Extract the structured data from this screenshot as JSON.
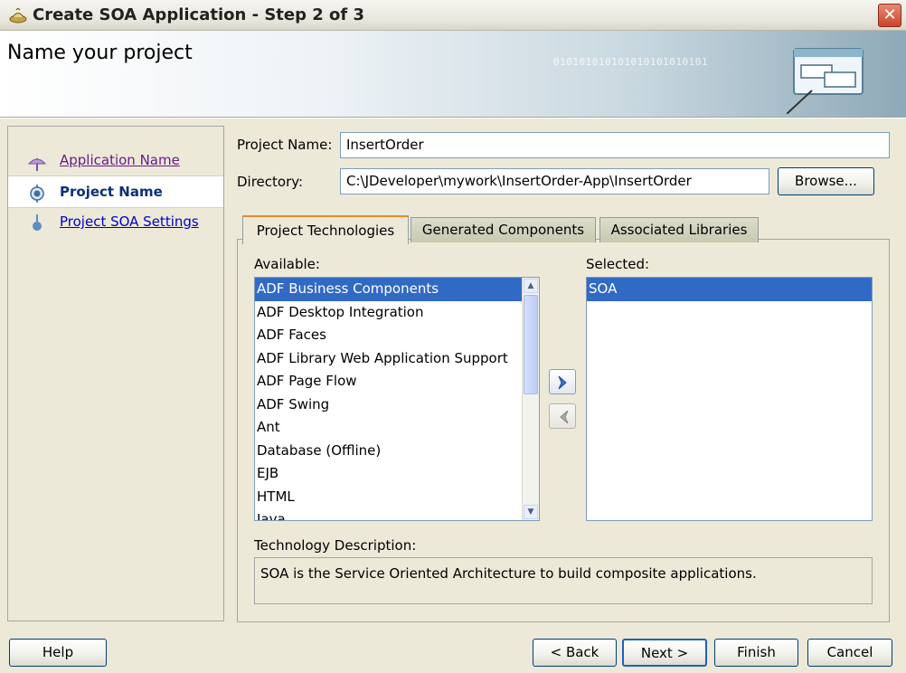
{
  "window": {
    "title": "Create SOA Application - Step 2 of 3",
    "close_glyph": "✕"
  },
  "header": {
    "title": "Name your project",
    "decoration_text": "010101010101010101010101"
  },
  "steps": [
    {
      "label": "Application Name",
      "state": "visited",
      "icon": "step-visited-icon"
    },
    {
      "label": "Project Name",
      "state": "current",
      "icon": "step-current-icon"
    },
    {
      "label": "Project SOA Settings",
      "state": "pending",
      "icon": "step-pending-icon"
    }
  ],
  "form": {
    "project_name_label": "Project Name:",
    "project_name_value": "InsertOrder",
    "directory_label": "Directory:",
    "directory_value": "C:\\JDeveloper\\mywork\\InsertOrder-App\\InsertOrder",
    "browse_label": "Browse..."
  },
  "tabs": [
    {
      "label": "Project Technologies",
      "active": true
    },
    {
      "label": "Generated Components",
      "active": false
    },
    {
      "label": "Associated Libraries",
      "active": false
    }
  ],
  "available": {
    "label": "Available:",
    "items": [
      "ADF Business Components",
      "ADF Desktop Integration",
      "ADF Faces",
      "ADF Library Web Application Support",
      "ADF Page Flow",
      "ADF Swing",
      "Ant",
      "Database (Offline)",
      "EJB",
      "HTML",
      "Java"
    ],
    "selected_index": 0
  },
  "selected": {
    "label": "Selected:",
    "items": [
      "SOA"
    ]
  },
  "shuttle": {
    "add_icon": "chevron-right-icon",
    "remove_icon": "chevron-left-icon"
  },
  "description": {
    "label": "Technology Description:",
    "text": "SOA is the Service Oriented Architecture to build composite applications."
  },
  "footer": {
    "help": "Help",
    "back": "< Back",
    "next": "Next >",
    "finish": "Finish",
    "cancel": "Cancel"
  },
  "colors": {
    "selection": "#316ac5",
    "visited_link": "#6a1b8a",
    "link": "#0000cc",
    "current_step": "#0b2f79"
  }
}
